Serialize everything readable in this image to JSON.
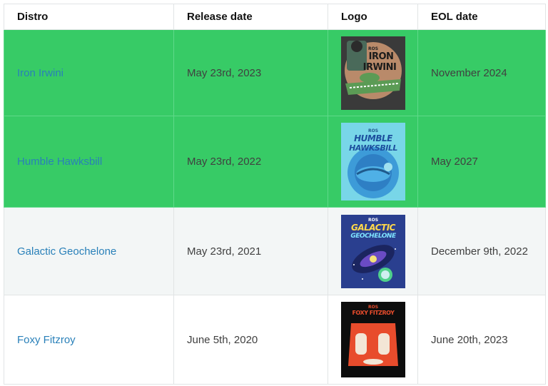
{
  "headers": {
    "distro": "Distro",
    "release_date": "Release date",
    "logo": "Logo",
    "eol_date": "EOL date"
  },
  "rows": [
    {
      "distro": "Iron Irwini",
      "release_date": "May 23rd, 2023",
      "eol_date": "November 2024",
      "logo": {
        "ros": "ROS",
        "line1": "IRON",
        "line2": "IRWINI"
      }
    },
    {
      "distro": "Humble Hawksbill",
      "release_date": "May 23rd, 2022",
      "eol_date": "May 2027",
      "logo": {
        "ros": "ROS",
        "line1": "HUMBLE",
        "line2": "HAWKSBILL"
      }
    },
    {
      "distro": "Galactic Geochelone",
      "release_date": "May 23rd, 2021",
      "eol_date": "December 9th, 2022",
      "logo": {
        "ros": "ROS",
        "line1": "GALACTIC",
        "line2": "GEOCHELONE"
      }
    },
    {
      "distro": "Foxy Fitzroy",
      "release_date": "June 5th, 2020",
      "eol_date": "June 20th, 2023",
      "logo": {
        "ros": "ROS",
        "line1": "FOXY FITZROY",
        "line2": ""
      }
    }
  ],
  "colors": {
    "active_row": "#37cb66",
    "link": "#2980b9",
    "odd_row": "#f3f6f6"
  }
}
